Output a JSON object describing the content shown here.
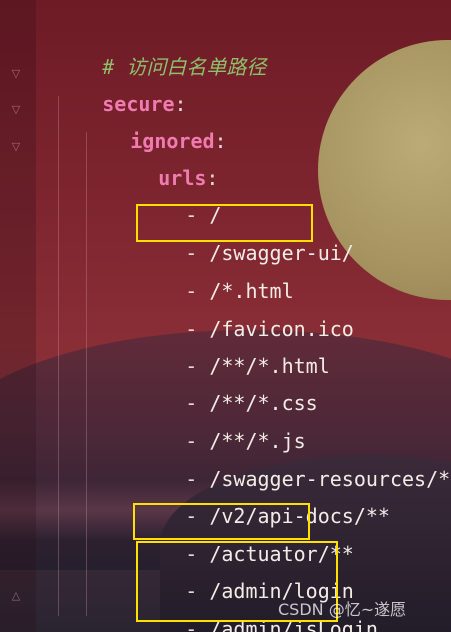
{
  "editor": {
    "comment": "# 访问白名单路径",
    "secure_key": "secure",
    "ignored_key": "ignored",
    "urls_key": "urls",
    "colon": ":",
    "dash": "-",
    "urls": [
      "/",
      "/swagger-ui/",
      "/*.html",
      "/favicon.ico",
      "/**/*.html",
      "/**/*.css",
      "/**/*.js",
      "/swagger-resources/**",
      "/v2/api-docs/**",
      "/actuator/**",
      "/admin/login",
      "/admin/isLogin"
    ],
    "highlighted": [
      "/swagger-ui/",
      "/actuator/**",
      "/admin/login",
      "/admin/isLogin"
    ]
  },
  "watermark": {
    "text": "CSDN @忆~遂愿"
  },
  "colors": {
    "comment": "#8fbf6a",
    "key": "#f07bb1",
    "value": "#f3ece6",
    "highlight": "#ffe000",
    "background": "#7a1e28"
  }
}
